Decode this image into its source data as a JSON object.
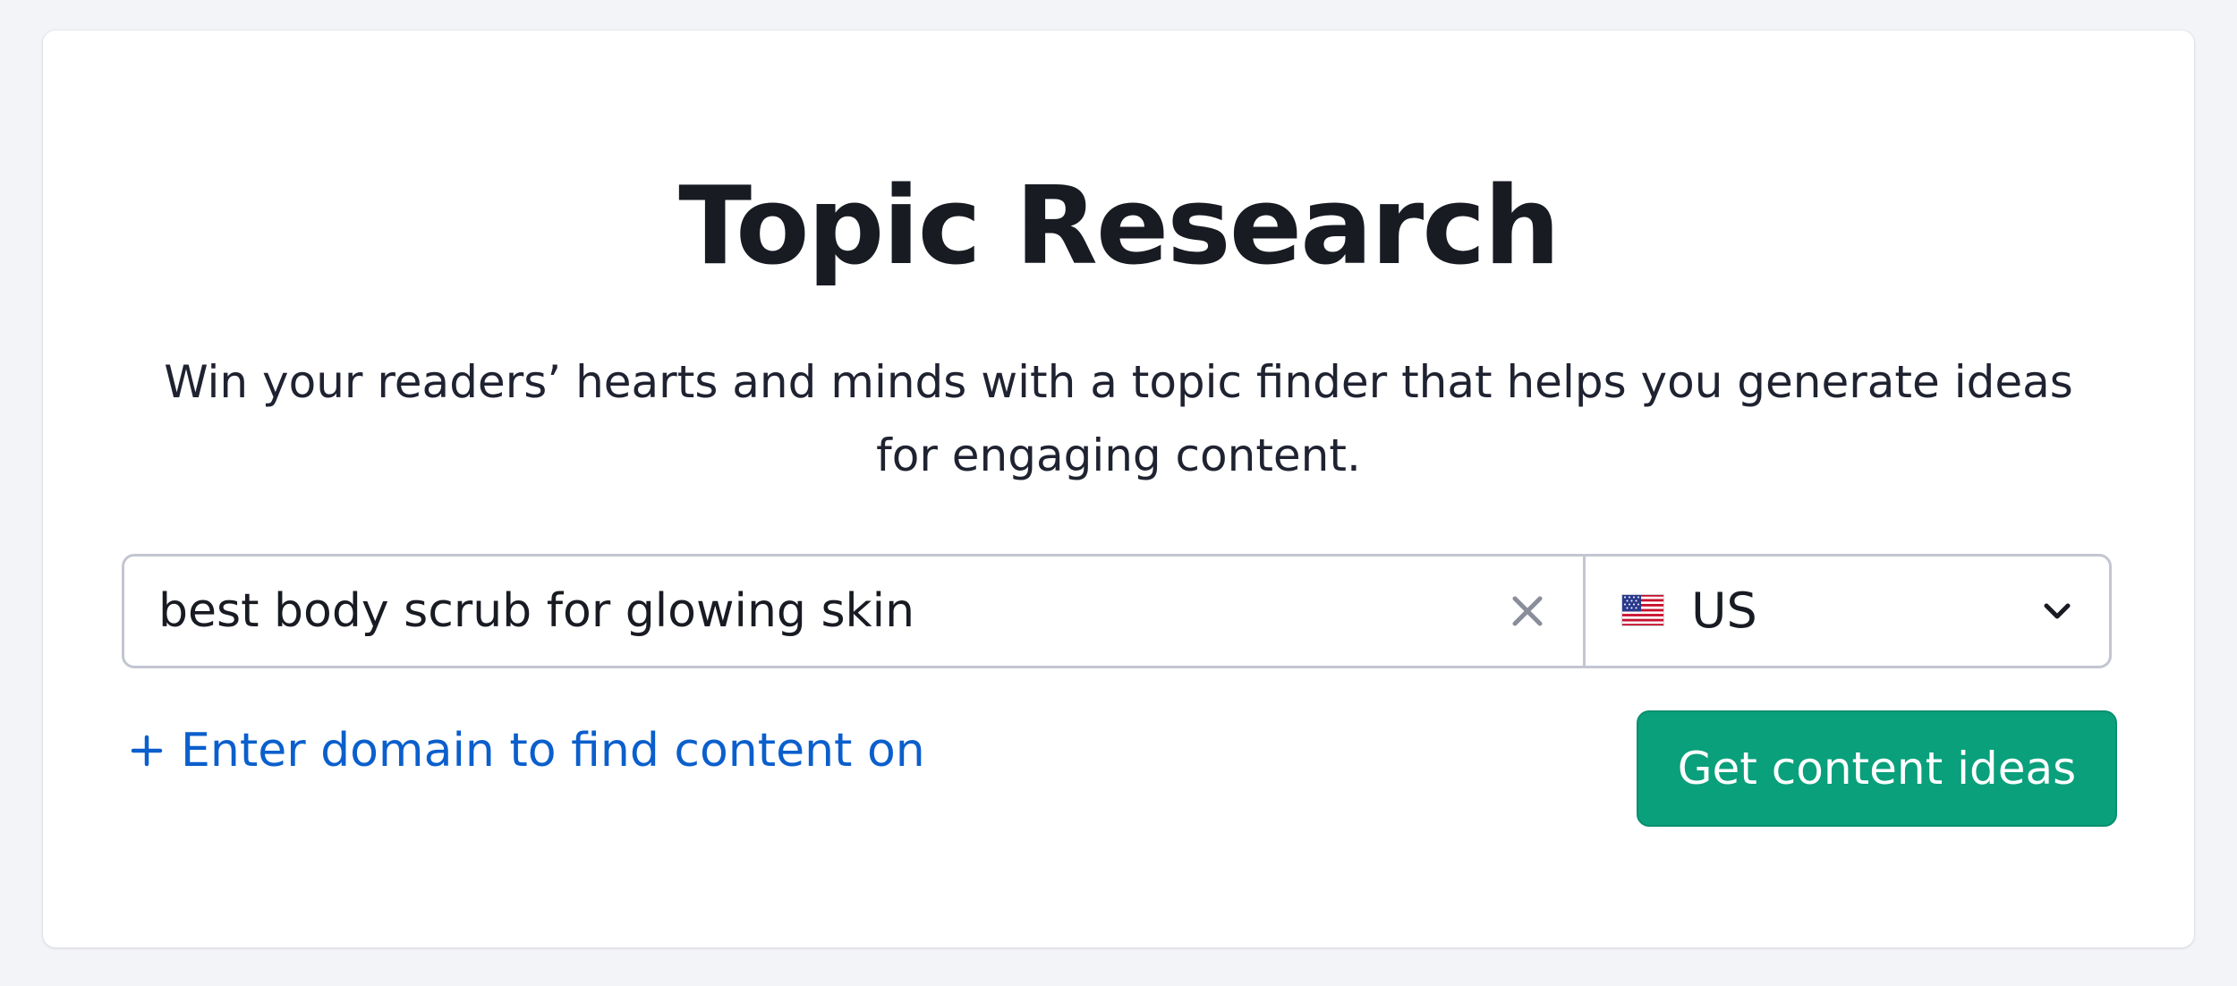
{
  "page": {
    "title": "Topic Research",
    "subtitle": "Win your readers’ hearts and minds with a topic finder that helps you generate ideas for engaging content."
  },
  "search": {
    "value": "best body scrub for glowing skin",
    "clear_icon": "close-icon"
  },
  "country": {
    "code": "US",
    "flag_icon": "us-flag-icon",
    "dropdown_icon": "chevron-down-icon"
  },
  "domain_link": {
    "icon": "plus-icon",
    "label": "Enter domain to find content on"
  },
  "cta": {
    "label": "Get content ideas"
  },
  "colors": {
    "background": "#f3f4f8",
    "card": "#ffffff",
    "title": "#191b23",
    "link": "#0b5fcc",
    "cta": "#0aa07c",
    "border": "#c3c6d1"
  }
}
